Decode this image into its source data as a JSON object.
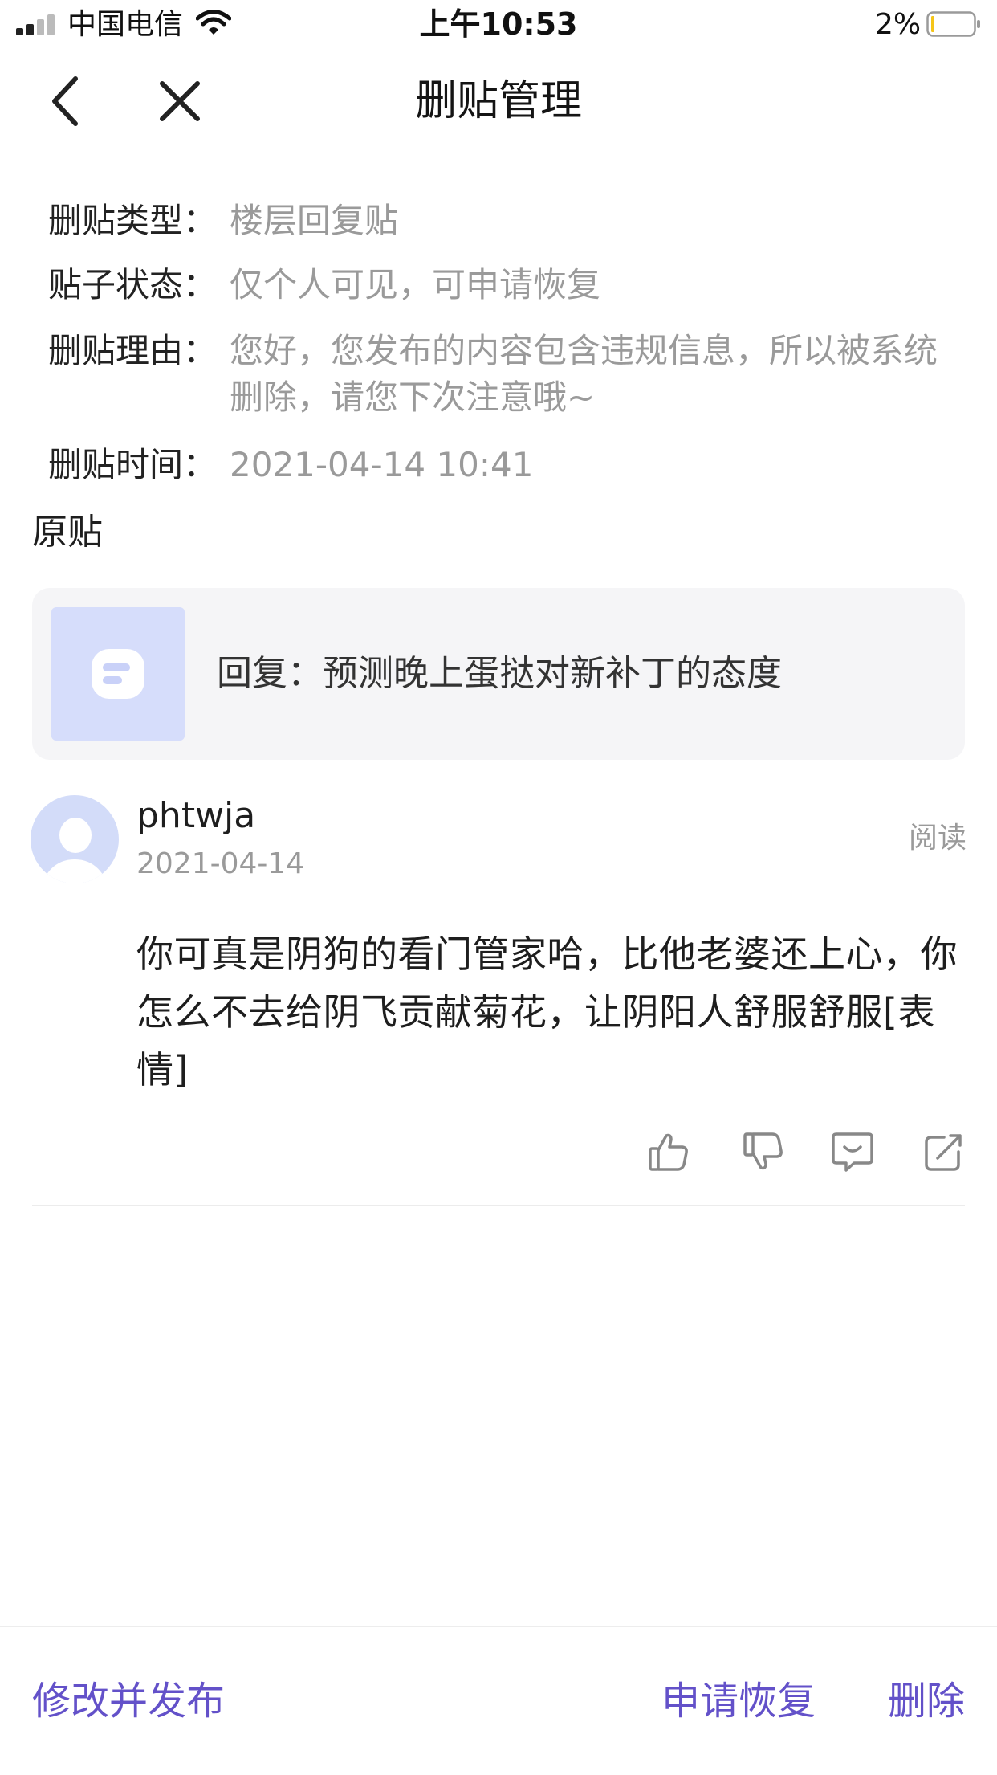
{
  "status_bar": {
    "carrier": "中国电信",
    "time": "上午10:53",
    "battery": "2%"
  },
  "nav": {
    "title": "删贴管理"
  },
  "info": {
    "type_label": "删贴类型：",
    "type_value": "楼层回复贴",
    "status_label": "贴子状态：",
    "status_value": "仅个人可见，可申请恢复",
    "reason_label": "删贴理由：",
    "reason_value": "您好，您发布的内容包含违规信息，所以被系统删除，请您下次注意哦~",
    "time_label": "删贴时间：",
    "time_value": "2021-04-14 10:41"
  },
  "original": {
    "section_title": "原贴",
    "title": "回复：预测晚上蛋挞对新补丁的态度"
  },
  "reply": {
    "username": "phtwja",
    "date": "2021-04-14",
    "read_label": "阅读",
    "body": "你可真是阴狗的看门管家哈，比他老婆还上心，你怎么不去给阴飞贡献菊花，让阴阳人舒服舒服[表情]"
  },
  "bottom": {
    "edit_publish": "修改并发布",
    "apply_restore": "申请恢复",
    "delete": "删除"
  },
  "colors": {
    "accent": "#6351c9",
    "muted_text": "#9a9a9a",
    "card_bg": "#f5f5f7",
    "avatar_bg": "#d3dcf9",
    "battery_low": "#f5c518"
  },
  "icons": [
    "back-arrow-icon",
    "close-icon",
    "wifi-icon",
    "battery-icon",
    "like-icon",
    "dislike-icon",
    "comment-icon",
    "share-icon"
  ]
}
